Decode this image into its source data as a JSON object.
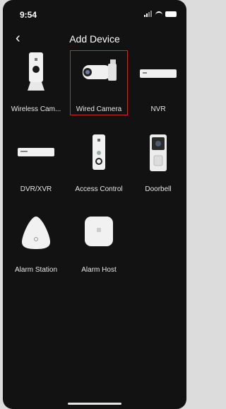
{
  "status_bar": {
    "time": "9:54"
  },
  "header": {
    "title": "Add Device"
  },
  "devices": [
    {
      "label": "Wireless Cam..."
    },
    {
      "label": "Wired Camera"
    },
    {
      "label": "NVR"
    },
    {
      "label": "DVR/XVR"
    },
    {
      "label": "Access Control"
    },
    {
      "label": "Doorbell"
    },
    {
      "label": "Alarm Station"
    },
    {
      "label": "Alarm Host"
    }
  ],
  "colors": {
    "background": "#121212",
    "selection": "#c42b2b",
    "text": "#e6e6e6"
  },
  "icons": {
    "back": "chevron-left-icon"
  }
}
